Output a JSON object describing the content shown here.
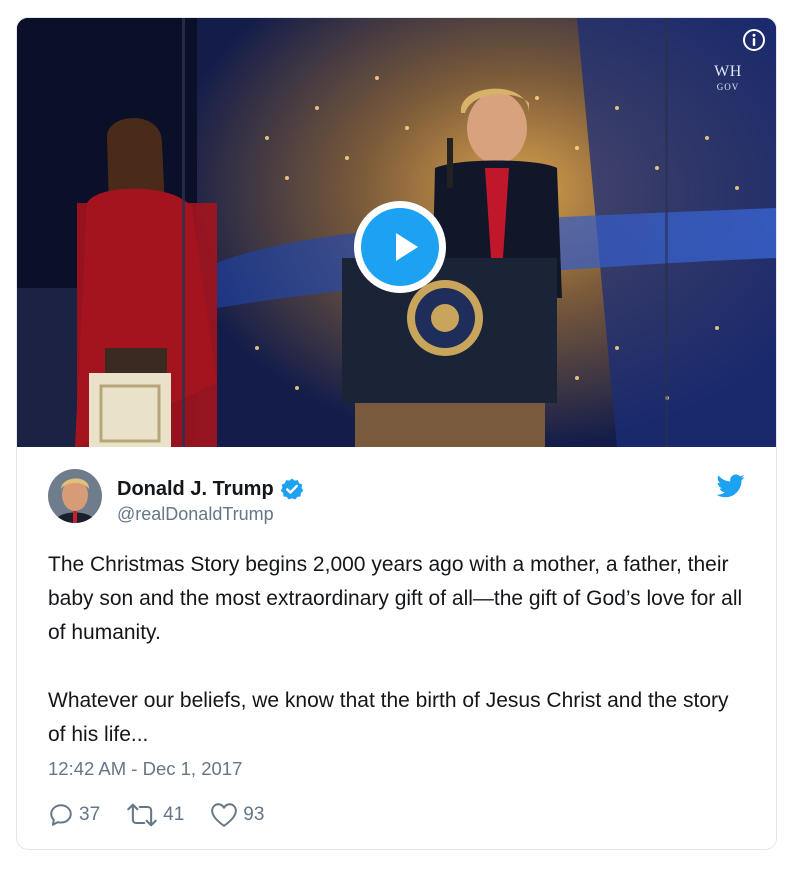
{
  "media": {
    "watermark": {
      "line1": "WH",
      "line2": "GOV"
    },
    "info_icon": "info-circle-icon",
    "play_icon": "play-icon"
  },
  "author": {
    "display_name": "Donald J. Trump",
    "handle": "@realDonaldTrump",
    "verified_icon": "verified-badge-icon"
  },
  "brand_icon": "twitter-bird-icon",
  "tweet": {
    "paragraph1": "The Christmas Story begins 2,000 years ago with a mother, a father, their baby son and the most extraordinary gift of all—the gift of God’s love for all of humanity.",
    "paragraph2": "Whatever our beliefs, we know that the birth of Jesus Christ and the story of his life...",
    "timestamp": "12:42 AM - Dec 1, 2017"
  },
  "actions": {
    "replies": "37",
    "retweets": "41",
    "likes": "93"
  },
  "colors": {
    "accent": "#1da1f2",
    "text": "#14171a",
    "secondary": "#657786",
    "border": "#e1e8ed"
  }
}
